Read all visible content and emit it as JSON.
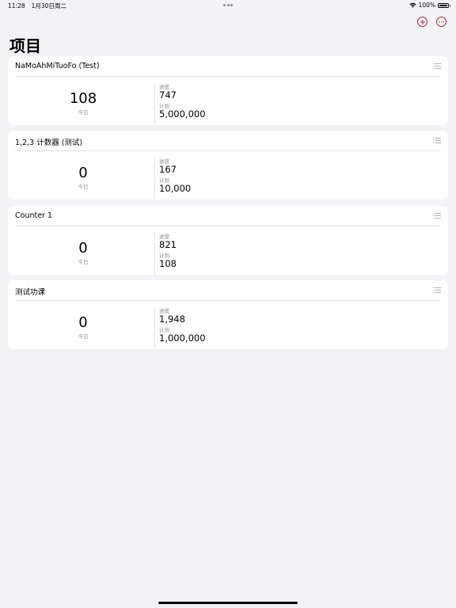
{
  "status_bar": {
    "time": "11:28",
    "date": "1月30日周二",
    "battery": "100%"
  },
  "nav": {
    "title": "项目"
  },
  "labels": {
    "today": "今日",
    "progress": "进度",
    "plan": "计划"
  },
  "projects": [
    {
      "name": "NaMoAhMiTuoFo (Test)",
      "today": "108",
      "progress": "747",
      "plan": "5,000,000"
    },
    {
      "name": "1,2,3 计数器 (测试)",
      "today": "0",
      "progress": "167",
      "plan": "10,000"
    },
    {
      "name": "Counter 1",
      "today": "0",
      "progress": "821",
      "plan": "108"
    },
    {
      "name": "测试功课",
      "today": "0",
      "progress": "1,948",
      "plan": "1,000,000"
    }
  ],
  "colors": {
    "accent": "#b0262f",
    "background": "#f2f2f7",
    "card": "#ffffff",
    "secondary_text": "#8e8e93"
  },
  "icons": {
    "add": "plus-circle-icon",
    "more": "ellipsis-circle-icon",
    "list": "list-icon",
    "wifi": "wifi-icon",
    "battery": "battery-icon"
  }
}
